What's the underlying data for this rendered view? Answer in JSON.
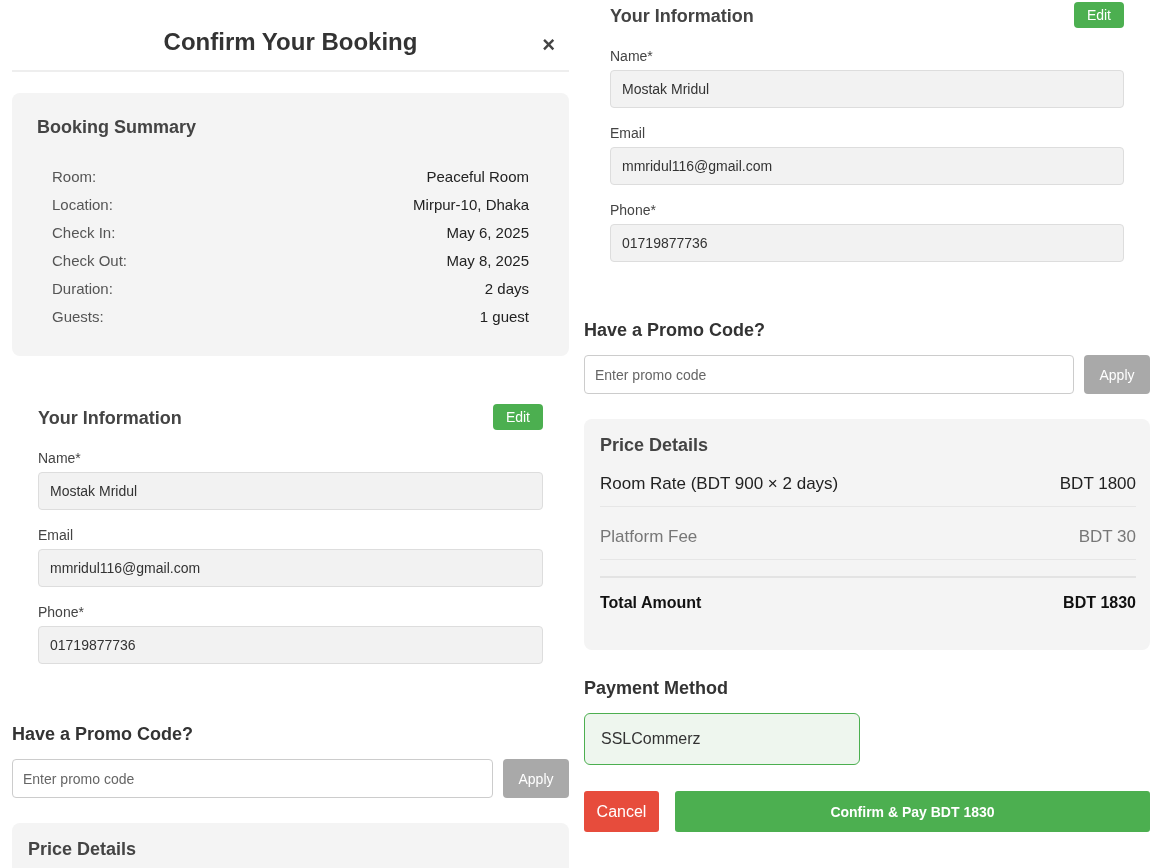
{
  "panels": [
    {
      "sections": [
        {
          "kind": "header",
          "title": "Confirm Your Booking",
          "close": "×"
        },
        {
          "kind": "summary",
          "title": "Booking Summary",
          "rows": [
            {
              "label": "Room:",
              "value": "Peaceful Room"
            },
            {
              "label": "Location:",
              "value": "Mirpur-10, Dhaka"
            },
            {
              "label": "Check In:",
              "value": "May 6, 2025"
            },
            {
              "label": "Check Out:",
              "value": "May 8, 2025"
            },
            {
              "label": "Duration:",
              "value": "2 days"
            },
            {
              "label": "Guests:",
              "value": "1 guest"
            }
          ]
        },
        {
          "kind": "info",
          "title": "Your Information",
          "edit": "Edit",
          "fields": [
            {
              "label": "Name*",
              "value": "Mostak Mridul"
            },
            {
              "label": "Email",
              "value": "mmridul116@gmail.com"
            },
            {
              "label": "Phone*",
              "value": "01719877736"
            }
          ]
        },
        {
          "kind": "promo",
          "title": "Have a Promo Code?",
          "placeholder": "Enter promo code",
          "button": "Apply",
          "disabled": true
        },
        {
          "kind": "price",
          "title": "Price Details"
        }
      ]
    },
    {
      "sections": [
        {
          "kind": "info",
          "title": "Your Information",
          "edit": "Edit",
          "fields": [
            {
              "label": "Name*",
              "value": "Mostak Mridul"
            },
            {
              "label": "Email",
              "value": "mmridul116@gmail.com"
            },
            {
              "label": "Phone*",
              "value": "01719877736"
            }
          ]
        },
        {
          "kind": "promo",
          "title": "Have a Promo Code?",
          "placeholder": "Enter promo code",
          "button": "Apply",
          "disabled": true
        },
        {
          "kind": "price",
          "title": "Price Details",
          "rows": [
            {
              "kind": "item",
              "label": "Room Rate (BDT 900 × 2 days)",
              "value": "BDT 1800"
            },
            {
              "kind": "fee",
              "label": "Platform Fee",
              "value": "BDT 30"
            },
            {
              "kind": "total",
              "label": "Total Amount",
              "value": "BDT 1830"
            }
          ]
        },
        {
          "kind": "payment",
          "title": "Payment Method",
          "options": [
            {
              "label": "SSLCommerz",
              "selected": true
            }
          ]
        },
        {
          "kind": "actions",
          "buttons": [
            {
              "kind": "cancel",
              "label": "Cancel"
            },
            {
              "kind": "confirm",
              "label": "Confirm & Pay BDT 1830"
            }
          ]
        }
      ]
    }
  ]
}
